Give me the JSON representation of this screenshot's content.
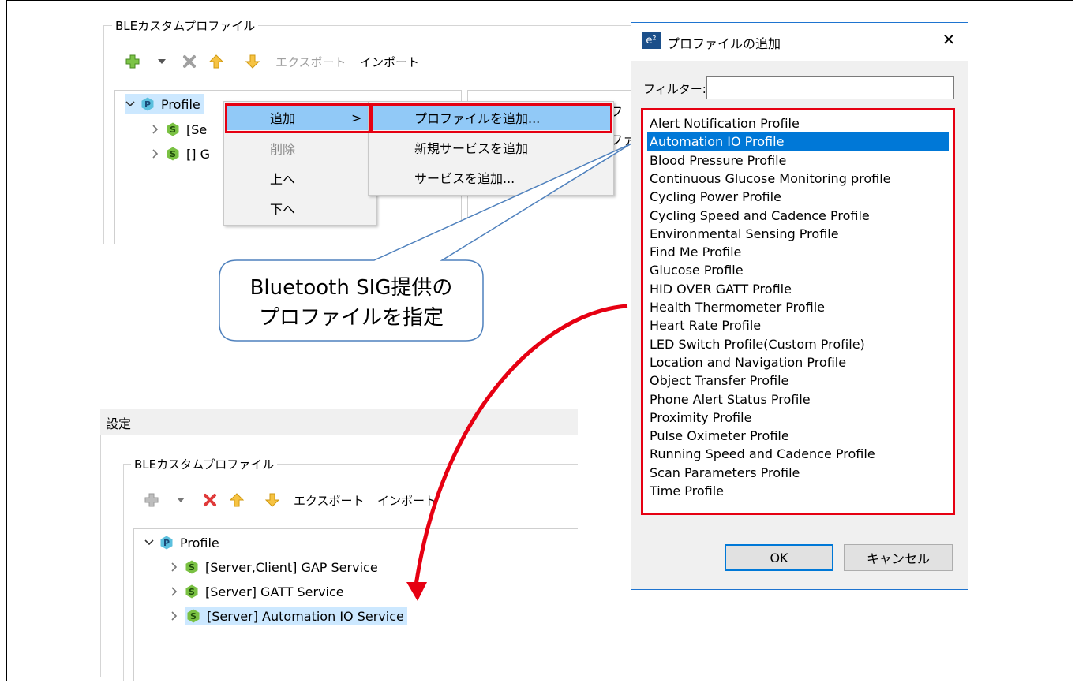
{
  "top_panel": {
    "group_title": "BLEカスタムプロファイル",
    "toolbar": {
      "export_label": "エクスポート",
      "import_label": "インポート"
    },
    "tree": {
      "root_label": "Profile",
      "items": [
        {
          "label": "[Se"
        },
        {
          "label": "[] G"
        }
      ]
    },
    "partial_text_1": "フ",
    "partial_text_2": "ファ"
  },
  "context_menu": {
    "items": [
      {
        "label": "追加",
        "arrow": ">"
      },
      {
        "label": "削除"
      },
      {
        "label": "上へ"
      },
      {
        "label": "下へ"
      }
    ],
    "submenu": [
      {
        "label": "プロファイルを追加..."
      },
      {
        "label": "新規サービスを追加"
      },
      {
        "label": "サービスを追加..."
      }
    ]
  },
  "callout": {
    "line1": "Bluetooth SIG提供の",
    "line2": "プロファイルを指定"
  },
  "bottom_panel": {
    "header": "設定",
    "group_title": "BLEカスタムプロファイル",
    "toolbar": {
      "export_label": "エクスポート",
      "import_label": "インポート"
    },
    "tree": {
      "root_label": "Profile",
      "items": [
        {
          "label": "[Server,Client] GAP Service"
        },
        {
          "label": "[Server] GATT Service"
        },
        {
          "label": "[Server] Automation IO Service"
        }
      ]
    }
  },
  "dialog": {
    "app_icon_text": "e²",
    "title": "プロファイルの追加",
    "close_label": "✕",
    "filter_label": "フィルター:",
    "filter_value": "",
    "selected_index": 1,
    "profiles": [
      "Alert Notification Profile",
      "Automation IO Profile",
      "Blood Pressure Profile",
      "Continuous Glucose Monitoring profile",
      "Cycling Power Profile",
      "Cycling Speed and Cadence Profile",
      "Environmental Sensing Profile",
      "Find Me Profile",
      "Glucose Profile",
      "HID OVER GATT Profile",
      "Health Thermometer Profile",
      "Heart Rate Profile",
      "LED Switch Profile(Custom Profile)",
      "Location and Navigation Profile",
      "Object Transfer Profile",
      "Phone Alert Status Profile",
      "Proximity Profile",
      "Pulse Oximeter Profile",
      "Running Speed and Cadence Profile",
      "Scan Parameters Profile",
      "Time Profile"
    ],
    "ok_label": "OK",
    "cancel_label": "キャンセル"
  },
  "colors": {
    "highlight_red": "#e60012",
    "selection_blue": "#0078d7",
    "menu_hover": "#91c9f7",
    "dialog_border": "#1e74d0",
    "service_green": "#7ac143",
    "profile_teal": "#5bc0de"
  }
}
